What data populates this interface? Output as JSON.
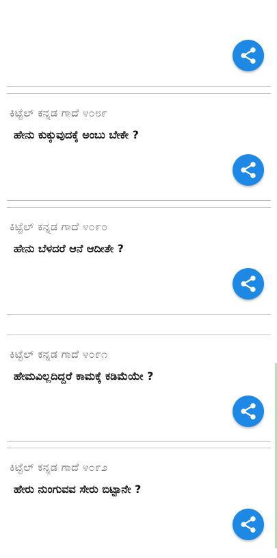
{
  "cards": [
    {
      "title": "",
      "text": ""
    },
    {
      "title": "ಕಿಟ್ಟೆಲ್ ಕನ್ನಡ ಗಾದೆ ೪೦೮೯",
      "text": "ಹೇನು ಕುಕ್ಕುವುದಕ್ಕೆ ಅಂಬು ಬೇಕೇ ?"
    },
    {
      "title": "ಕಿಟ್ಟೆಲ್ ಕನ್ನಡ ಗಾದೆ ೪೦೯೦",
      "text": "ಹೇನು ಬೆಳದರೆ ಆನೆ ಆದೀತೇ ?"
    },
    {
      "title": "ಕಿಟ್ಟೆಲ್ ಕನ್ನಡ ಗಾದೆ ೪೦೯೧",
      "text": "ಹೇಮವಿಲ್ಲದಿದ್ದರೆ ಕಾಮಕ್ಕೆ ಕಡಿಮೆಯೇ ?"
    },
    {
      "title": "ಕಿಟ್ಟೆಲ್ ಕನ್ನಡ ಗಾದೆ ೪೦೯೨",
      "text": "ಹೇರು ನುಂಗುವವ ಸೇರು ಬಿಟ್ಟಾನೇ ?"
    }
  ],
  "icons": {
    "share": "share-icon"
  },
  "colors": {
    "share_button": "#1e88e5",
    "divider": "#bdbdbd",
    "title_text": "#6f6f6f"
  }
}
